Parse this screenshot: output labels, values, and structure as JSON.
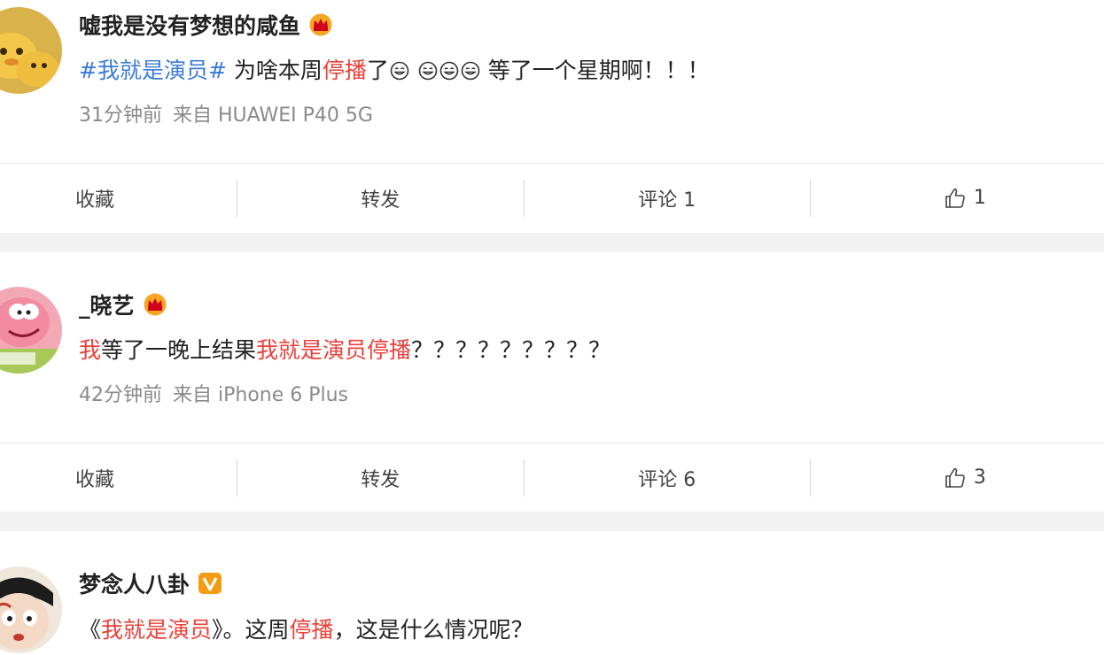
{
  "posts": [
    {
      "username": "嘘我是没有梦想的咸鱼",
      "badge": "crown-icon",
      "content": {
        "hashtag": "#我就是演员#",
        "part1": " 为啥本周",
        "highlight1": "停播",
        "part2": "了",
        "part3": " 等了一个星期啊！！！"
      },
      "time": "31分钟前",
      "source": "来自 HUAWEI P40 5G",
      "actions": {
        "favorite": "收藏",
        "repost": "转发",
        "comment": "评论 1",
        "like": "1"
      }
    },
    {
      "username": "_晓艺",
      "badge": "crown-icon",
      "content": {
        "highlight1": "我",
        "part1": "等了一晚上结果",
        "highlight2": "我就是演员停播",
        "part2": "？？？？？？？？？"
      },
      "time": "42分钟前",
      "source": "来自 iPhone 6 Plus",
      "actions": {
        "favorite": "收藏",
        "repost": "转发",
        "comment": "评论 6",
        "like": "3"
      }
    },
    {
      "username": "梦念人八卦",
      "badge": "verified-v-icon",
      "content": {
        "open": "《",
        "highlight1": "我就是演员",
        "part1": "》。这周",
        "highlight2": "停播",
        "part2": "，这是什么情况呢？"
      }
    }
  ],
  "colors": {
    "hashtag": "#3a7bd5",
    "highlight": "#e9413a",
    "meta": "#8a8a8a",
    "separator": "#f2f2f2"
  }
}
